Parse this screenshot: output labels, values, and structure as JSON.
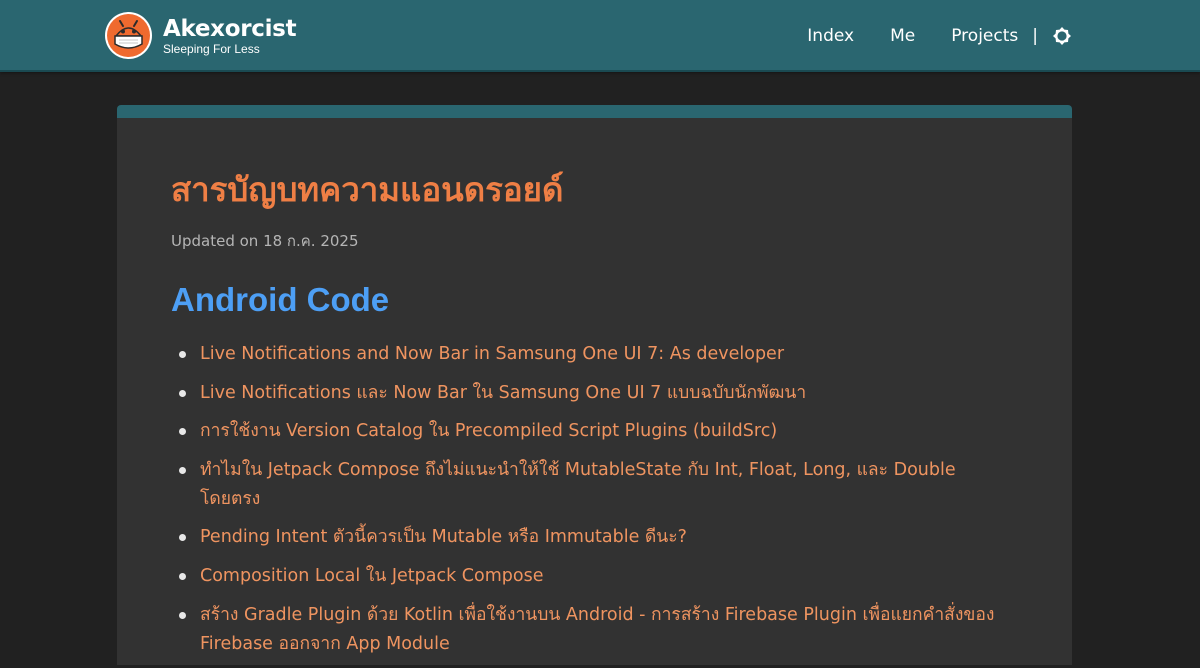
{
  "site": {
    "title": "Akexorcist",
    "subtitle": "Sleeping For Less",
    "logo_icon": "android-mascot-icon"
  },
  "nav": {
    "items": [
      {
        "label": "Index"
      },
      {
        "label": "Me"
      },
      {
        "label": "Projects"
      }
    ],
    "separator": "|",
    "theme_toggle_icon": "sun-icon"
  },
  "colors": {
    "header": "#2a6670",
    "title": "#ef7f45",
    "link": "#ef9460",
    "section_heading": "#4d9ff5",
    "page_bg": "#212121",
    "card_bg": "#323232"
  },
  "page": {
    "title": "สารบัญบทความแอนดรอยด์",
    "updated": "Updated on 18 ก.ค. 2025"
  },
  "sections": [
    {
      "heading": "Android Code",
      "articles": [
        "Live Notifications and Now Bar in Samsung One UI 7: As developer",
        "Live Notifications และ Now Bar ใน Samsung One UI 7 แบบฉบับนักพัฒนา",
        "การใช้งาน Version Catalog ใน Precompiled Script Plugins (buildSrc)",
        "ทำไมใน Jetpack Compose ถึงไม่แนะนำให้ใช้ MutableState กับ Int, Float, Long, และ Double โดยตรง",
        "Pending Intent ตัวนี้ควรเป็น Mutable หรือ Immutable ดีนะ?",
        "Composition Local ใน Jetpack Compose",
        "สร้าง Gradle Plugin ด้วย Kotlin เพื่อใช้งานบน Android - การสร้าง Firebase Plugin เพื่อแยกคำสั่งของ Firebase ออกจาก App Module"
      ]
    }
  ]
}
